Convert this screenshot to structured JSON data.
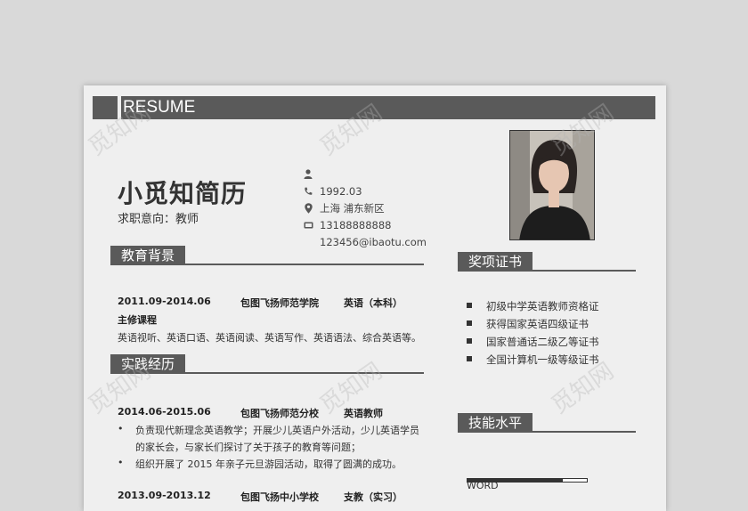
{
  "header": {
    "banner": "RESUME"
  },
  "profile": {
    "name": "小觅知简历",
    "intent": "求职意向：教师"
  },
  "contact": {
    "birth": "1992.03",
    "address": "上海  浦东新区",
    "phone": "13188888888",
    "email": "123456@ibaotu.com"
  },
  "education": {
    "title": "教育背景",
    "date": "2011.09-2014.06",
    "school": "包图飞扬师范学院",
    "major": "英语（本科）",
    "courses_label": "主修课程",
    "courses": "英语视听、英语口语、英语阅读、英语写作、英语语法、综合英语等。"
  },
  "experience": {
    "title": "实践经历",
    "jobs": [
      {
        "date": "2014.06-2015.06",
        "org": "包图飞扬师范分校",
        "role": "英语教师",
        "lines": [
          {
            "bullet": "•",
            "text": "负责现代新理念英语教学；开展少儿英语户外活动，少儿英语学员"
          },
          {
            "bullet": "",
            "text": "的家长会，与家长们探讨了关于孩子的教育等问题；"
          },
          {
            "bullet": "•",
            "text": "组织开展了 2015 年亲子元旦游园活动，取得了圆满的成功。"
          }
        ]
      },
      {
        "date": "2013.09-2013.12",
        "org": "包图飞扬中小学校",
        "role": "支教（实习）"
      }
    ]
  },
  "certificates": {
    "title": "奖项证书",
    "items": [
      "初级中学英语教师资格证",
      "获得国家英语四级证书",
      "国家普通话二级乙等证书",
      "全国计算机一级等级证书"
    ]
  },
  "skills": {
    "title": "技能水平",
    "items": [
      {
        "name": "WORD",
        "level": 0.8
      }
    ]
  },
  "watermark": "觅知网",
  "colors": {
    "accent": "#5a5a5a",
    "paper": "#efefef",
    "background": "#d9d9d9"
  },
  "icons": [
    "person-icon",
    "phone-icon",
    "location-icon",
    "mobile-icon"
  ]
}
